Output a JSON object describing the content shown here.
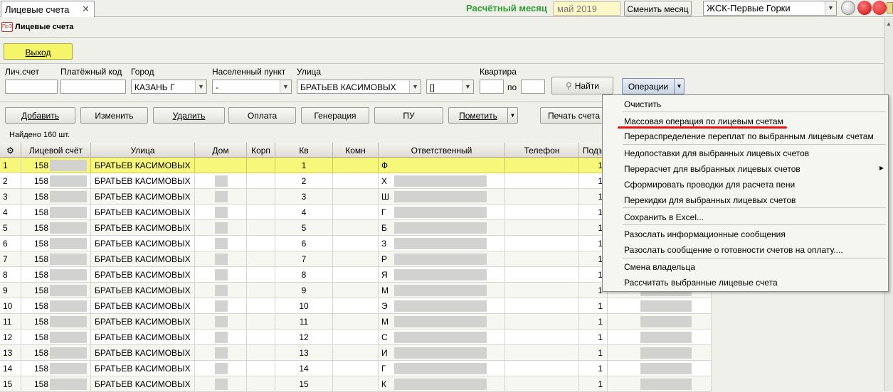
{
  "window": {
    "tab_label": "Лицевые счета",
    "tab_close": "✕",
    "month_label": "Расчётный месяц",
    "month_value": "май 2019",
    "change_month_button": "Сменить месяц",
    "company": "ЖСК-Первые Горки"
  },
  "panel": {
    "logo_text": "ПрЭ",
    "title": "Лицевые счета",
    "exit_button": "Выход"
  },
  "filters": {
    "account_label": "Лич.счет",
    "payment_code_label": "Платёжный код",
    "city_label": "Город",
    "city_value": "КАЗАНЬ Г",
    "locality_label": "Населенный пункт",
    "locality_value": "-",
    "street_label": "Улица",
    "street_value": "БРАТЬЕВ КАСИМОВЫХ",
    "house_value": "[]",
    "flat_label": "Квартира",
    "flat_to_label": "по",
    "find_button": "Найти",
    "operations_button": "Операции"
  },
  "actions": {
    "add": "Добавить",
    "edit": "Изменить",
    "delete": "Удалить",
    "payment": "Оплата",
    "generation": "Генерация",
    "pu": "ПУ",
    "mark": "Пометить",
    "print": "Печать счета"
  },
  "found_text": "Найдено 160 шт.",
  "table": {
    "headers": {
      "num": "",
      "account": "Лицевой счёт",
      "street": "Улица",
      "house": "Дом",
      "korp": "Корп",
      "kv": "Кв",
      "komn": "Комн",
      "resp": "Ответственный",
      "phone": "Телефон",
      "sub": "Подъ"
    },
    "rows": [
      {
        "n": "1",
        "acc": "158",
        "street": "БРАТЬЕВ КАСИМОВЫХ",
        "kv": "1",
        "resp": "Ф",
        "sub": "1"
      },
      {
        "n": "2",
        "acc": "158",
        "street": "БРАТЬЕВ КАСИМОВЫХ",
        "kv": "2",
        "resp": "Х",
        "sub": "1"
      },
      {
        "n": "3",
        "acc": "158",
        "street": "БРАТЬЕВ КАСИМОВЫХ",
        "kv": "3",
        "resp": "Ш",
        "sub": "1"
      },
      {
        "n": "4",
        "acc": "158",
        "street": "БРАТЬЕВ КАСИМОВЫХ",
        "kv": "4",
        "resp": "Г",
        "sub": "1"
      },
      {
        "n": "5",
        "acc": "158",
        "street": "БРАТЬЕВ КАСИМОВЫХ",
        "kv": "5",
        "resp": "Б",
        "sub": "1"
      },
      {
        "n": "6",
        "acc": "158",
        "street": "БРАТЬЕВ КАСИМОВЫХ",
        "kv": "6",
        "resp": "З",
        "sub": "1"
      },
      {
        "n": "7",
        "acc": "158",
        "street": "БРАТЬЕВ КАСИМОВЫХ",
        "kv": "7",
        "resp": "Р",
        "sub": "1"
      },
      {
        "n": "8",
        "acc": "158",
        "street": "БРАТЬЕВ КАСИМОВЫХ",
        "kv": "8",
        "resp": "Я",
        "sub": "1"
      },
      {
        "n": "9",
        "acc": "158",
        "street": "БРАТЬЕВ КАСИМОВЫХ",
        "kv": "9",
        "resp": "М",
        "sub": "1"
      },
      {
        "n": "10",
        "acc": "158",
        "street": "БРАТЬЕВ КАСИМОВЫХ",
        "kv": "10",
        "resp": "Э",
        "sub": "1"
      },
      {
        "n": "11",
        "acc": "158",
        "street": "БРАТЬЕВ КАСИМОВЫХ",
        "kv": "11",
        "resp": "М",
        "sub": "1"
      },
      {
        "n": "12",
        "acc": "158",
        "street": "БРАТЬЕВ КАСИМОВЫХ",
        "kv": "12",
        "resp": "С",
        "sub": "1"
      },
      {
        "n": "13",
        "acc": "158",
        "street": "БРАТЬЕВ КАСИМОВЫХ",
        "kv": "13",
        "resp": "И",
        "sub": "1"
      },
      {
        "n": "14",
        "acc": "158",
        "street": "БРАТЬЕВ КАСИМОВЫХ",
        "kv": "14",
        "resp": "Г",
        "sub": "1"
      },
      {
        "n": "15",
        "acc": "158",
        "street": "БРАТЬЕВ КАСИМОВЫХ",
        "kv": "15",
        "resp": "К",
        "sub": "1"
      }
    ]
  },
  "menu": {
    "items": [
      "Очистить",
      "Массовая операция по лицевым счетам",
      "Перераспределение переплат по выбранным лицевым счетам",
      "Недопоставки для выбранных лицевых счетов",
      "Перерасчет для выбранных лицевых счетов",
      "Сформировать проводки для расчета пени",
      "Перекидки для выбранных лицевых счетов",
      "Сохранить в Excel...",
      "Разослать информационные сообщения",
      "Разослать сообщение о готовности счетов на оплату....",
      "Смена владельца",
      "Рассчитать выбранные лицевые счета"
    ],
    "submenu_arrow": "▸"
  },
  "colors": {
    "selected_row": "#f7f77a",
    "month_label": "#2e9e2e",
    "exit_button": "#f5f56a",
    "highlight_underline": "#e01414"
  }
}
